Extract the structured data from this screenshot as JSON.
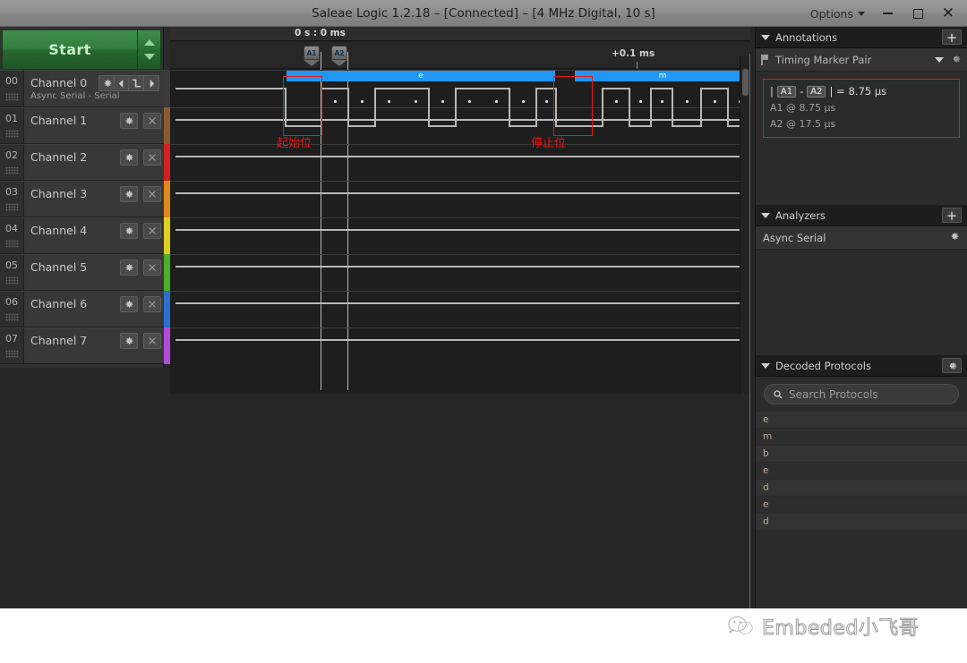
{
  "window": {
    "title": "Saleae Logic 1.2.18 – [Connected] – [4 MHz Digital, 10 s]",
    "options_label": "Options",
    "minimize_icon": "minimize-icon",
    "maximize_icon": "maximize-icon",
    "close_icon": "close-icon"
  },
  "sidebar": {
    "start_label": "Start",
    "channels": [
      {
        "num": "00",
        "name": "Channel 0",
        "sub": "Async Serial - Serial",
        "color": "#3a3a3a",
        "has_nav": true
      },
      {
        "num": "01",
        "name": "Channel 1",
        "sub": "",
        "color": "#8a5a2b",
        "has_nav": false
      },
      {
        "num": "02",
        "name": "Channel 2",
        "sub": "",
        "color": "#d32020",
        "has_nav": false
      },
      {
        "num": "03",
        "name": "Channel 3",
        "sub": "",
        "color": "#e08a1e",
        "has_nav": false
      },
      {
        "num": "04",
        "name": "Channel 4",
        "sub": "",
        "color": "#e0d020",
        "has_nav": false
      },
      {
        "num": "05",
        "name": "Channel 5",
        "sub": "",
        "color": "#4caf28",
        "has_nav": false
      },
      {
        "num": "06",
        "name": "Channel 6",
        "sub": "",
        "color": "#2b6fd0",
        "has_nav": false
      },
      {
        "num": "07",
        "name": "Channel 7",
        "sub": "",
        "color": "#b44ad8",
        "has_nav": false
      }
    ]
  },
  "timeline": {
    "origin_label": "0 s : 0 ms",
    "tick_label": "+0.1 ms",
    "marker_a1": "A1",
    "marker_a2": "A2"
  },
  "waveform": {
    "decoded_frame_1": "e",
    "decoded_frame_2": "m",
    "note_start_bit": "起始位",
    "note_stop_bit": "停止位"
  },
  "annotations": {
    "title": "Annotations",
    "add_label": "+",
    "pair_label": "Timing Marker Pair",
    "delta_prefix": "|",
    "delta_a1": "A1",
    "delta_dash": "-",
    "delta_a2": "A2",
    "delta_eq": "| =",
    "delta_value": "8.75 µs",
    "a1_line": "A1  @   8.75 µs",
    "a2_line": "A2  @   17.5 µs"
  },
  "analyzers": {
    "title": "Analyzers",
    "add_label": "+",
    "items": [
      {
        "name": "Async Serial"
      }
    ]
  },
  "decoded": {
    "title": "Decoded Protocols",
    "search_placeholder": "Search Protocols",
    "rows": [
      "e",
      "m",
      "b",
      "e",
      "d",
      "e",
      "d"
    ]
  },
  "watermark": {
    "text": "Embeded小飞哥",
    "icon": "wechat-icon"
  },
  "colors": {
    "accent_blue": "#2196f3",
    "annotation_red": "#e21b1b",
    "start_green": "#327d3d"
  }
}
